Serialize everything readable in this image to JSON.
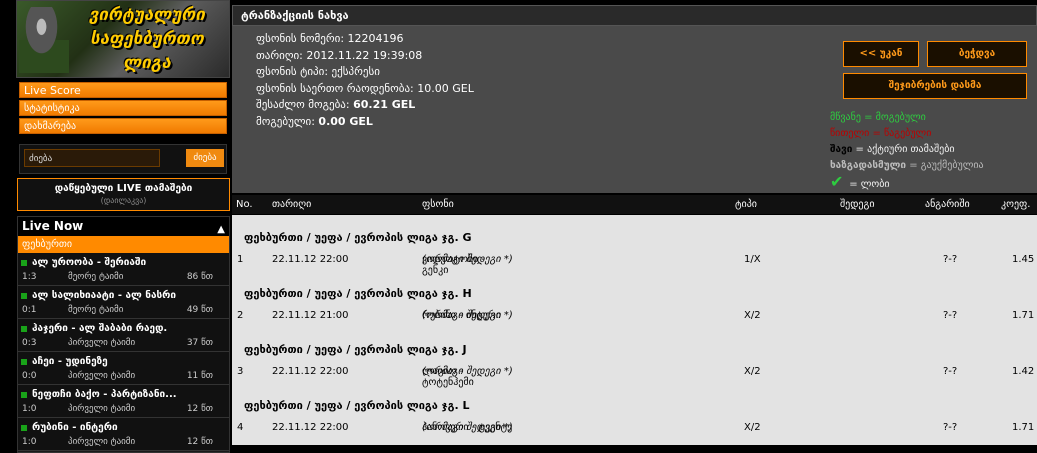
{
  "logo": {
    "line1": "ვირტუალური",
    "line2": "საფეხბურთო",
    "line3": "ლიგა"
  },
  "menu": {
    "live_score": "Live Score",
    "statistics": "სტატისტიკა",
    "help": "დახმარება"
  },
  "search": {
    "placeholder": "",
    "value": "ძიება",
    "button": "ძიება"
  },
  "saved_live": {
    "title": "დაწყებული LIVE თამაშები",
    "subtitle": "(დაილაკვა)"
  },
  "live_now": {
    "title": "Live Now",
    "category": "ფეხბურთი",
    "matches": [
      {
        "name": "ალ უროობა - შერიაში",
        "score": "1:3",
        "stage": "მეორე ტაიმი",
        "minute": "86 წთ"
      },
      {
        "name": "ალ სალიხიაატი - ალ ნასრი",
        "score": "0:1",
        "stage": "მეორე ტაიმი",
        "minute": "49 წთ"
      },
      {
        "name": "ჰაჯერი - ალ შაბაბი რაედ.",
        "score": "0:3",
        "stage": "პირველი ტაიმი",
        "minute": "37 წთ"
      },
      {
        "name": "აჩეი - უდინეზე",
        "score": "0:0",
        "stage": "პირველი ტაიმი",
        "minute": "11 წთ"
      },
      {
        "name": "ნეფთჩი ბაქო - პარტიზანი...",
        "score": "1:0",
        "stage": "პირველი ტაიმი",
        "minute": "12 წთ"
      },
      {
        "name": "რუბინი - ინტერი",
        "score": "1:0",
        "stage": "პირველი ტაიმი",
        "minute": "12 წთ"
      }
    ]
  },
  "page_title": "ტრანზაქციის ნახვა",
  "info": {
    "ticket_no_label": "ფსონის ნომერი:",
    "ticket_no": "12204196",
    "date_label": "თარიღი:",
    "date": "2012.11.22 19:39:08",
    "type_label": "ფსონის ტიპი:",
    "type": "ექსპრესი",
    "total_label": "ფსონის საერთო რაოდენობა:",
    "total": "10.00 GEL",
    "possible_label": "შესაძლო მოგება:",
    "possible": "60.21 GEL",
    "won_label": "მოგებული:",
    "won": "0.00 GEL"
  },
  "buttons": {
    "back": "<< უკან",
    "print": "ბეჭდვა",
    "save_result": "შეჯიბრების დასმა"
  },
  "legend": {
    "green": "მწვანე",
    "green_desc": "= მოგებული",
    "red": "წითელი",
    "red_desc": "= წაგებული",
    "black": "შავი",
    "black_desc": "= აქტიური თამაშები",
    "grey": "ხაზგადასმული",
    "grey_desc": "= გაუქმებულია",
    "check_desc": "= ლობი"
  },
  "table": {
    "headers": {
      "no": "No.",
      "date": "თარიღი",
      "bet": "ფსონი",
      "type": "ტიპი",
      "result": "შედეგი",
      "score": "ანგარიში",
      "coef": "კოეფ."
    },
    "groups": [
      {
        "title": "ფეხბურთი / უეფა / ევროპის ლიგა ჯგ. G",
        "no": "1",
        "date": "22.11.12 22:00",
        "match": "ვიდეოტონი - გენკი",
        "note": "(ორმაგი შედეგი *)",
        "type": "1/X",
        "score": "?-?",
        "coef": "1.45"
      },
      {
        "title": "ფეხბურთი / უეფა / ევროპის ლიგა ჯგ. H",
        "no": "2",
        "date": "22.11.12 21:00",
        "match": "რუბინი - ინტერი",
        "note": "(ორმაგი შედეგი *)",
        "type": "X/2",
        "score": "?-?",
        "coef": "1.71"
      },
      {
        "title": "ფეხბურთი / უეფა / ევროპის ლიგა ჯგ. J",
        "no": "3",
        "date": "22.11.12 22:00",
        "match": "ლაციო - ტოტენჰემი",
        "note": "(ორმაგი შედეგი *)",
        "type": "X/2",
        "score": "?-?",
        "coef": "1.42"
      },
      {
        "title": "ფეხბურთი / უეფა / ევროპის ლიგა ჯგ. L",
        "no": "4",
        "date": "22.11.12 22:00",
        "match": "ჰანოვერი - ტვენტე",
        "note": "(ორმაგი შედეგი *)",
        "type": "X/2",
        "score": "?-?",
        "coef": "1.71"
      }
    ]
  }
}
